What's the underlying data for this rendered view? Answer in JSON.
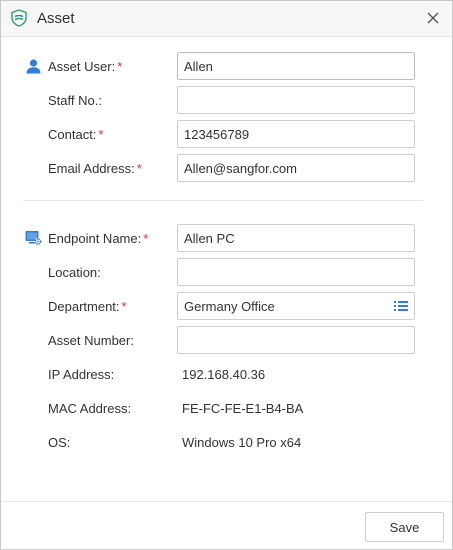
{
  "dialog": {
    "title": "Asset",
    "close_icon": "close-icon",
    "app_icon": "shield-logo-icon"
  },
  "colors": {
    "required": "#e0302f",
    "accent": "#2f7fd8"
  },
  "user_section": {
    "icon": "user-icon",
    "asset_user": {
      "label": "Asset User:",
      "required": "*",
      "value": "Allen"
    },
    "staff_no": {
      "label": "Staff No.:",
      "value": ""
    },
    "contact": {
      "label": "Contact:",
      "required": "*",
      "value": "123456789"
    },
    "email": {
      "label": "Email Address:",
      "required": "*",
      "value": "Allen@sangfor.com"
    }
  },
  "endpoint_section": {
    "icon": "endpoint-settings-icon",
    "endpoint_name": {
      "label": "Endpoint Name:",
      "required": "*",
      "value": "Allen PC"
    },
    "location": {
      "label": "Location:",
      "value": ""
    },
    "department": {
      "label": "Department:",
      "required": "*",
      "value": "Germany Office",
      "icon": "list-icon"
    },
    "asset_number": {
      "label": "Asset Number:",
      "value": ""
    },
    "ip_address": {
      "label": "IP Address:",
      "value": "192.168.40.36"
    },
    "mac_address": {
      "label": "MAC Address:",
      "value": "FE-FC-FE-E1-B4-BA"
    },
    "os": {
      "label": "OS:",
      "value": "Windows 10 Pro x64"
    }
  },
  "footer": {
    "save_label": "Save"
  }
}
